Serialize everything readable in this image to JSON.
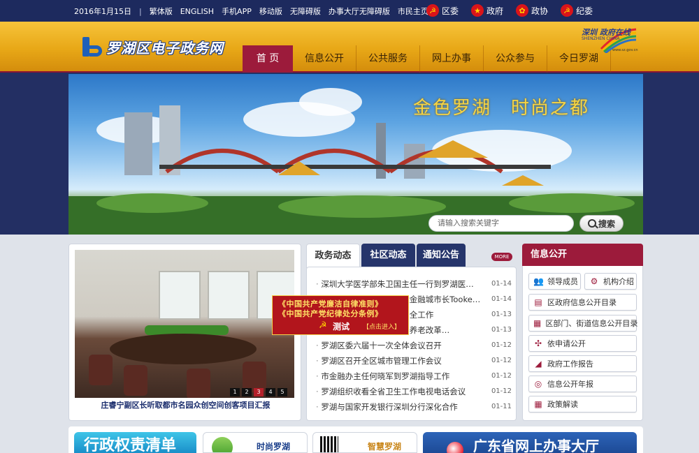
{
  "topbar": {
    "date": "2016年1月15日",
    "separator": "|",
    "links": [
      "繁体版",
      "ENGLISH",
      "手机APP",
      "移动版",
      "无障碍版",
      "办事大厅无障碍版",
      "市民主页"
    ],
    "orgs": [
      "区委",
      "政府",
      "政协",
      "纪委"
    ]
  },
  "header": {
    "site_name": "罗湖区电子政务网",
    "nav": [
      "首 页",
      "信息公开",
      "公共服务",
      "网上办事",
      "公众参与",
      "今日罗湖"
    ],
    "shenzhen_logo": {
      "line1": "深圳 政府在线",
      "line2": "SHENZHEN CHINA",
      "line3": "www.sz.gov.cn"
    }
  },
  "banner": {
    "slogan": "金色罗湖　时尚之都",
    "search_placeholder": "请输入搜索关键字",
    "search_button": "搜索"
  },
  "photo": {
    "caption": "庄睿宁副区长听取都市名园众创空间创客项目汇报",
    "pager": [
      "1",
      "2",
      "3",
      "4",
      "5"
    ],
    "active_page": 3
  },
  "news": {
    "tabs": [
      "政务动态",
      "社区动态",
      "通知公告"
    ],
    "more": "MORE",
    "items": [
      {
        "title": "深圳大学医学部朱卫国主任一行到罗湖医…",
        "date": "01-14"
      },
      {
        "title": "罗湖区领导会见英国伦敦金融城市长Tooke爵士一行…",
        "date": "01-14"
      },
      {
        "title": "区委书记带队检查消防安全工作",
        "date": "01-13"
      },
      {
        "title": "罗湖区召开机关事业单位养老改革…",
        "date": "01-13"
      },
      {
        "title": "罗湖区委六届十一次全体会议召开",
        "date": "01-12"
      },
      {
        "title": "罗湖区召开全区城市管理工作会议",
        "date": "01-12"
      },
      {
        "title": "市金融办主任何晓军到罗湖指导工作",
        "date": "01-12"
      },
      {
        "title": "罗湖组织收看全省卫生工作电视电话会议",
        "date": "01-12"
      },
      {
        "title": "罗湖与国家开发银行深圳分行深化合作",
        "date": "01-11"
      }
    ]
  },
  "float_ad": {
    "line1": "《中国共产党廉洁自律准则》",
    "line2": "《中国共产党纪律处分条例》",
    "line3": "测试",
    "line4": "【点击进入】"
  },
  "info": {
    "title": "信息公开",
    "buttons": [
      "领导成员",
      "机构介绍",
      "区政府信息公开目录",
      "区部门、街道信息公开目录",
      "依申请公开",
      "政府工作报告",
      "信息公开年报",
      "政策解读"
    ]
  },
  "bottom": {
    "card1": "行政权责清单",
    "card2": "时尚罗湖",
    "card3": "智慧罗湖",
    "card4": "广东省网上办事大厅"
  },
  "colors": {
    "navy": "#1d2a5e",
    "gold": "#e8a817",
    "crimson": "#9c1b3b"
  }
}
